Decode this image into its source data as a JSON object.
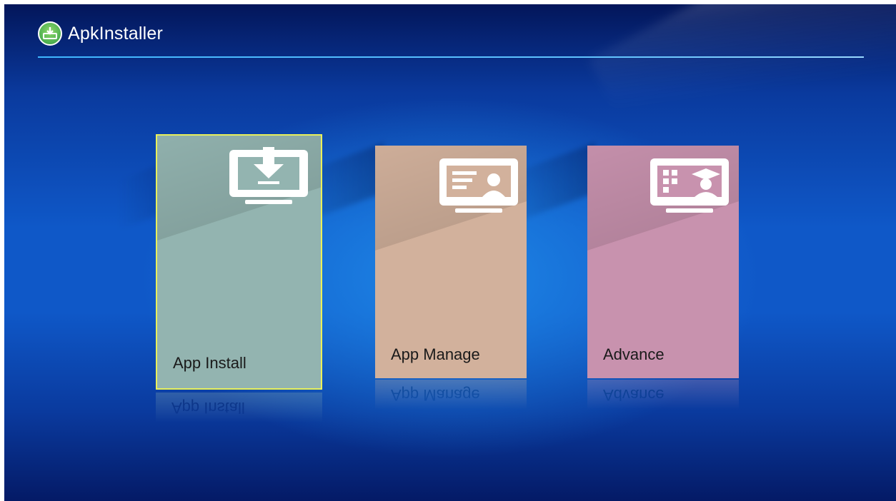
{
  "app": {
    "title": "ApkInstaller",
    "logo_icon": "apk-download-logo-icon"
  },
  "colors": {
    "header_rule": "#3fb6ff",
    "focus_border": "#e9f05a",
    "tile_install": "#93b4b0",
    "tile_manage": "#d2b19c",
    "tile_advance": "#c892ae"
  },
  "tiles": [
    {
      "label": "App Install",
      "icon": "monitor-download-icon",
      "focused": true
    },
    {
      "label": "App Manage",
      "icon": "monitor-contact-card-icon",
      "focused": false
    },
    {
      "label": "Advance",
      "icon": "monitor-graduation-icon",
      "focused": false
    }
  ]
}
